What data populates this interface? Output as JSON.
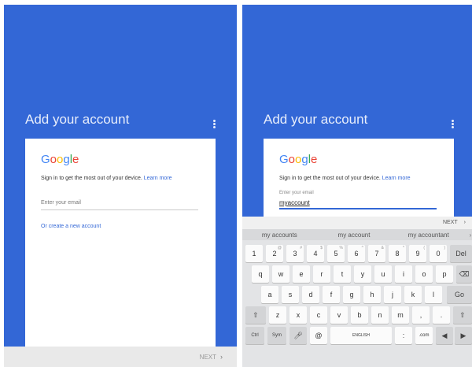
{
  "left_screen": {
    "title": "Add your account",
    "google_logo": [
      "G",
      "o",
      "o",
      "g",
      "l",
      "e"
    ],
    "logo_colors": [
      "#4285f4",
      "#ea4335",
      "#fbbc05",
      "#4285f4",
      "#34a853",
      "#ea4335"
    ],
    "sign_in_text": "Sign in to get the most out of your device.",
    "learn_more": "Learn more",
    "email_placeholder": "Enter your email",
    "create_account": "Or create a new account",
    "next_label": "NEXT"
  },
  "right_screen": {
    "title": "Add your account",
    "sign_in_text": "Sign in to get the most out of your device.",
    "learn_more": "Learn more",
    "email_label": "Enter your email",
    "email_value": "myaccount",
    "keyboard_next": "NEXT",
    "suggestions": [
      "my accounts",
      "my account",
      "my accountant"
    ],
    "keys": {
      "row1": [
        "1",
        "2",
        "3",
        "4",
        "5",
        "6",
        "7",
        "8",
        "9",
        "0"
      ],
      "row1_sup": [
        "",
        "@",
        "#",
        "$",
        "%",
        "^",
        "&",
        "*",
        "(",
        ")"
      ],
      "row1_end": "Del",
      "row2": [
        "q",
        "w",
        "e",
        "r",
        "t",
        "y",
        "u",
        "i",
        "o",
        "p"
      ],
      "row3": [
        "a",
        "s",
        "d",
        "f",
        "g",
        "h",
        "j",
        "k",
        "l"
      ],
      "row3_end": "Go",
      "row4": [
        "z",
        "x",
        "c",
        "v",
        "b",
        "n",
        "m"
      ],
      "row5": [
        "Ctrl",
        "Sym",
        ".com"
      ],
      "space_label": "ENGLISH"
    }
  },
  "accent_color": "#3367d6"
}
